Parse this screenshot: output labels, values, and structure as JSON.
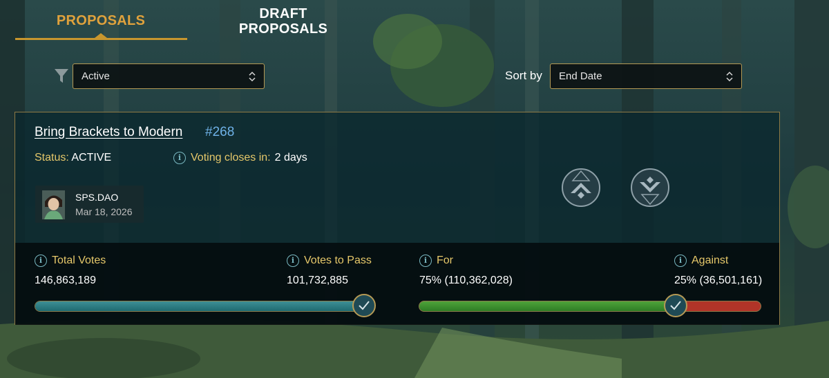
{
  "tabs": [
    {
      "label": "PROPOSALS",
      "active": true
    },
    {
      "label": "DRAFT PROPOSALS",
      "active": false
    }
  ],
  "filter": {
    "icon": "filter-icon",
    "selected": "Active"
  },
  "sort": {
    "label": "Sort by",
    "selected": "End Date"
  },
  "proposal": {
    "title": "Bring Brackets to Modern",
    "number": "#268",
    "status_label": "Status:",
    "status_value": "ACTIVE",
    "closes_label": "Voting closes in:",
    "closes_value": "2 days",
    "author": {
      "name": "SPS.DAO",
      "date": "Mar 18, 2026",
      "avatar": "avatar-portrait"
    },
    "vote_up_icon": "upvote-icon",
    "vote_down_icon": "downvote-icon",
    "stats": {
      "total_votes_label": "Total Votes",
      "total_votes_value": "146,863,189",
      "votes_to_pass_label": "Votes to Pass",
      "votes_to_pass_value": "101,732,885",
      "for_label": "For",
      "for_value": "75% (110,362,028)",
      "against_label": "Against",
      "against_value": "25% (36,501,161)",
      "total_progress_fraction": 1.0,
      "for_fraction": 0.75
    }
  },
  "colors": {
    "accent_gold": "#e0a23c",
    "link_blue": "#6fb2e8",
    "for_green": "#4ea33a",
    "against_red": "#b13428",
    "total_teal": "#3d8f95"
  }
}
